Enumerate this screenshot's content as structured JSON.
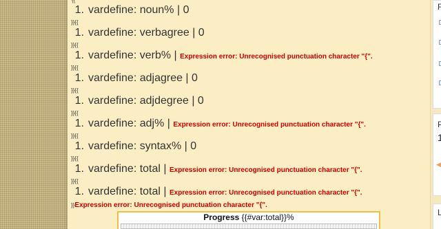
{
  "top_stub": "{{",
  "items": [
    {
      "num": "1.",
      "text": "vardefine: noun% | 0",
      "error": ""
    },
    {
      "num": "1.",
      "text": "vardefine: verbagree | 0",
      "error": ""
    },
    {
      "num": "1.",
      "text": "vardefine: verb% | ",
      "error": "Expression error: Unrecognised punctuation character \"{\"."
    },
    {
      "num": "1.",
      "text": "vardefine: adjagree | 0",
      "error": ""
    },
    {
      "num": "1.",
      "text": "vardefine: adjdegree | 0",
      "error": ""
    },
    {
      "num": "1.",
      "text": "vardefine: adj% | ",
      "error": "Expression error: Unrecognised punctuation character \"{\"."
    },
    {
      "num": "1.",
      "text": "vardefine: syntax% | 0",
      "error": ""
    },
    {
      "num": "1.",
      "text": "vardefine: total | ",
      "error": "Expression error: Unrecognised punctuation character \"{\"."
    },
    {
      "num": "1.",
      "text": "vardefine: total | ",
      "error": "Expression error: Unrecognised punctuation character \"{\"."
    }
  ],
  "separator": "}}{{",
  "final_line": {
    "prefix": "}}",
    "error": "Expression error: Unrecognised punctuation character \"{\"."
  },
  "progress": {
    "title": "Progress",
    "value_text": "{{#var:total}}%"
  },
  "sidebar": {
    "letter_top": "R",
    "letter_mid": "P",
    "big_number": "1",
    "letter_bottom": "L"
  }
}
